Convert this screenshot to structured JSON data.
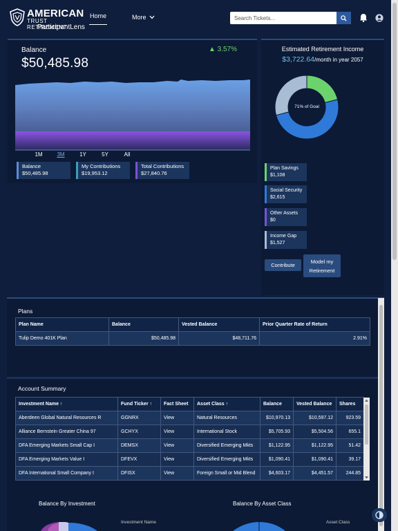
{
  "header": {
    "logo_line1": "AMERICAN",
    "logo_line2": "TRUST RETIREMENT",
    "logo_line3": "ParticipantLens",
    "nav_home": "Home",
    "nav_more": "More",
    "search_placeholder": "Search Tickets...",
    "icons": [
      "search-icon",
      "bell-icon",
      "user-icon",
      "chevron-down-icon"
    ]
  },
  "balance": {
    "title": "Balance",
    "change": "▲ 3.57%",
    "amount": "$50,485.98",
    "periods": [
      "1M",
      "3M",
      "1Y",
      "5Y",
      "All"
    ],
    "active_period": "3M",
    "chips": [
      {
        "label": "Balance",
        "value": "$50,485.98",
        "color": "#5b8cd8"
      },
      {
        "label": "My Contributions",
        "value": "$19,953.12",
        "color": "#3aa0b8"
      },
      {
        "label": "Total Contributions",
        "value": "$27,840.76",
        "color": "#7b52d8"
      }
    ]
  },
  "retirement": {
    "title": "Estimated Retirement Income",
    "amount": "$3,722.64",
    "amount_suffix": "/month in year 2057",
    "donut_label": "71% of Goal",
    "goal_percent": 71,
    "segments": [
      {
        "label": "Plan Savings",
        "value": "$1,108",
        "color": "#6cd36c"
      },
      {
        "label": "Social Security",
        "value": "$2,615",
        "color": "#2f7ad9"
      },
      {
        "label": "Other Assets",
        "value": "$0",
        "color": "#7b52d8"
      },
      {
        "label": "Income Gap",
        "value": "$1,527",
        "color": "#a8bcd4"
      }
    ],
    "contribute_label": "Contribute",
    "model_label_1": "Model my",
    "model_label_2": "Retirement"
  },
  "plans": {
    "title": "Plans",
    "columns": [
      "Plan Name",
      "Balance",
      "Vested Balance",
      "Prior Quarter Rate of Return"
    ],
    "rows": [
      [
        "Tulip Demo 401K Plan",
        "$50,485.98",
        "$48,711.76",
        "2.91%"
      ]
    ]
  },
  "account": {
    "title": "Account Summary",
    "columns": [
      "Investment Name ↑",
      "Fund Ticker ↑",
      "Fact Sheet",
      "Asset Class ↑",
      "Balance",
      "Vested Balance",
      "Shares"
    ],
    "rows": [
      [
        "Aberdeen Global Natural Resources R",
        "GGNRX",
        "View",
        "Natural Resources",
        "$10,970.13",
        "$10,597.12",
        "923.59"
      ],
      [
        "Alliance Bernstein Greater China 97",
        "GCHYX",
        "View",
        "International Stock",
        "$5,705.93",
        "$5,504.56",
        "655.1"
      ],
      [
        "DFA Emerging Markets Small Cap I",
        "DEMSX",
        "View",
        "Diversified Emerging Mkts",
        "$1,122.95",
        "$1,122.95",
        "51.42"
      ],
      [
        "DFA Emerging Markets Value I",
        "DFEVX",
        "View",
        "Diversified Emerging Mkts",
        "$1,090.41",
        "$1,090.41",
        "39.17"
      ],
      [
        "DFA International Small Company I",
        "DFISX",
        "View",
        "Foreign Small or Mid Blend",
        "$4,603.17",
        "$4,451.57",
        "244.85"
      ]
    ]
  },
  "charts": {
    "by_investment": "Balance By Investment",
    "by_investment_legend": "Investment Name",
    "by_asset": "Balance By Asset Class",
    "by_asset_legend": "Asset Class"
  }
}
